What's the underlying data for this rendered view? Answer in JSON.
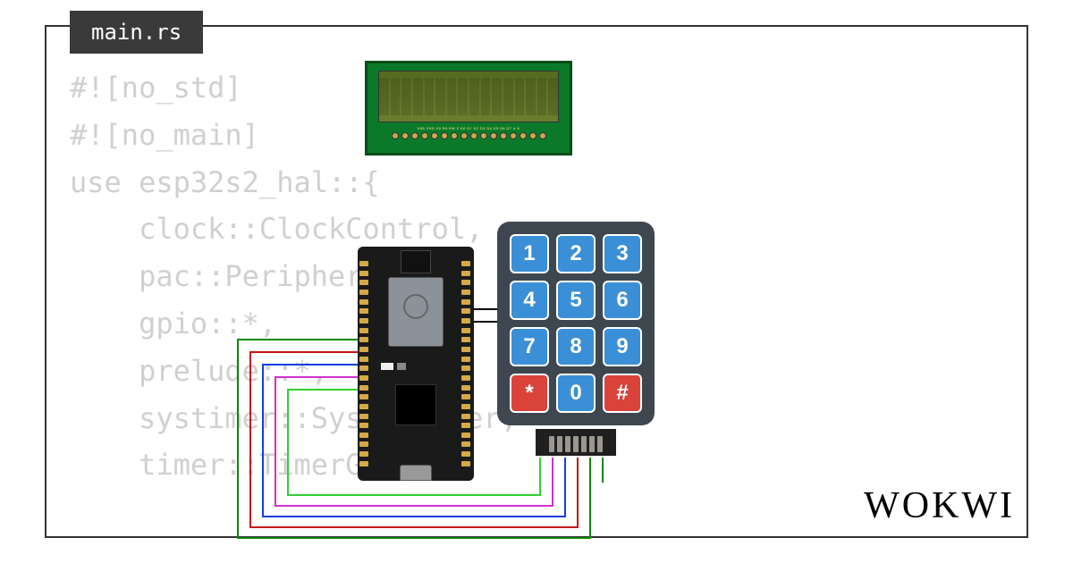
{
  "tab": {
    "filename": "main.rs"
  },
  "code": {
    "lines": [
      "#![no_std]",
      "#![no_main]",
      "",
      "use esp32s2_hal::{",
      "    clock::ClockControl,",
      "    pac::Peripherals,",
      "    gpio::*,",
      "    prelude::*,",
      "    systimer::SystemTimer,",
      "    timer::TimerGroup,"
    ]
  },
  "brand": "WOKWI",
  "lcd": {
    "pin_labels": "VSS VDD V0 RS RW E D0 D1 D2 D3 D4 D5 D6 D7 A K",
    "pin_count": 16,
    "char_count": 16
  },
  "board": {
    "pin_rows": 22
  },
  "keypad": {
    "keys": [
      "1",
      "2",
      "3",
      "4",
      "5",
      "6",
      "7",
      "8",
      "9",
      "*",
      "0",
      "#"
    ],
    "red_keys": [
      "*",
      "#"
    ],
    "connector_pins": 7
  },
  "wires": {
    "colors": {
      "green": "#0a8a0a",
      "red": "#c41818",
      "blue": "#1040e0",
      "magenta": "#d030d0",
      "lime": "#30d030",
      "black": "#000"
    }
  }
}
